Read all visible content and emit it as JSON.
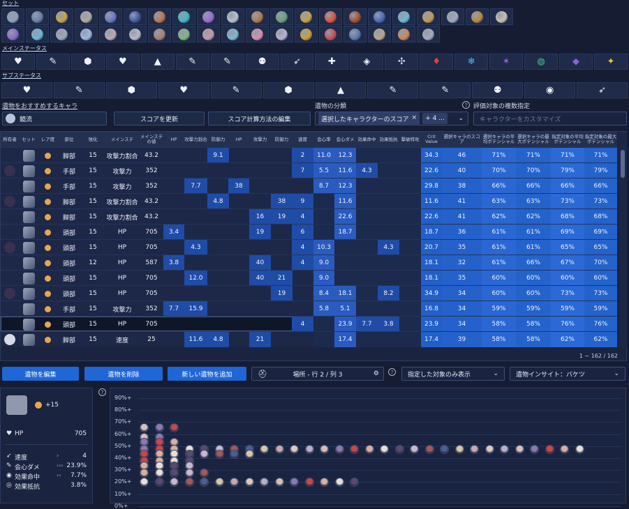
{
  "sections": {
    "set": "セット",
    "main_stat": "メインステータス",
    "sub_stat": "サブステータス"
  },
  "set_icons": {
    "row1": [
      "#8fa0b8",
      "#6a7fa8",
      "#c8a24a",
      "#b0a9a0",
      "#6b74c8",
      "#3c5aa8",
      "#b9764b",
      "#3bb8c8",
      "#9a6ad8",
      "#b8c0cc",
      "#b07a4a",
      "#6aa07a",
      "#c8a040",
      "#d8563a",
      "#a85030",
      "#4a6ab8",
      "#6ab8d0",
      "#c89850",
      "#a0a8c0",
      "#b88a3a",
      "#c8c0a8"
    ],
    "row2": [
      "#8a6ac8",
      "#6ab8d8",
      "#a0a8b8",
      "#9ab8e0",
      "#c0a8b0",
      "#b8b8c8",
      "#a88070",
      "#7ab880",
      "#c898a8",
      "#7ab8d0",
      "#d890a8",
      "#b8b0d0",
      "#c8a030",
      "#c85050",
      "#5a7ab0",
      "#b8a888",
      "#c88858",
      "#a8a8b8"
    ]
  },
  "main_stat_icons": [
    "hp-icon",
    "atk-percent-icon",
    "def-percent-icon",
    "heart-icon",
    "attack-icon",
    "crit-rate-icon",
    "crit-dmg-icon",
    "healing-icon",
    "energy-icon",
    "plus-icon",
    "effect-icon",
    "ice-grid-icon",
    "fire-icon",
    "ice-icon",
    "lightning-icon",
    "wind-icon",
    "quantum-icon",
    "imaginary-icon"
  ],
  "main_stat_glyphs": [
    "♥",
    "✎",
    "⬢",
    "♥",
    "▲",
    "✎",
    "✎",
    "⚉",
    "➶",
    "✚",
    "◈",
    "✣",
    "♦",
    "❄",
    "✶",
    "◍",
    "◆",
    "✦"
  ],
  "main_stat_colors": [
    "#eef2fa",
    "#eef2fa",
    "#eef2fa",
    "#eef2fa",
    "#eef2fa",
    "#eef2fa",
    "#eef2fa",
    "#eef2fa",
    "#eef2fa",
    "#eef2fa",
    "#eef2fa",
    "#c9d6f0",
    "#e0443a",
    "#5ab8e8",
    "#a060e0",
    "#40c890",
    "#8a60e0",
    "#e8c830"
  ],
  "sub_stat_glyphs": [
    "♥",
    "✎",
    "⬢",
    "♥",
    "✎",
    "⬢",
    "▲",
    "✎",
    "✎",
    "⚉",
    "◉",
    "➶"
  ],
  "labels": {
    "recommend_char": "遺物をおすすめするキャラ",
    "relic_class": "遺物の分類",
    "eval_target": "評価対象の複数指定",
    "char_name": "鏡流",
    "update_score": "スコアを更新",
    "edit_score": "スコア計算方法の編集",
    "chip": "選択したキャラクターのスコア",
    "chip_more": "+ 4 ...",
    "customize_placeholder": "キャラクターをカスタマイズ",
    "help": "?",
    "close": "×",
    "dropdown": "⌄"
  },
  "table": {
    "headers": [
      "所有者",
      "セット",
      "レア度",
      "部位",
      "強化",
      "メインステ",
      "メインステの値",
      "HP",
      "攻撃力割合",
      "防御力",
      "HP",
      "攻撃力",
      "防御力",
      "速度",
      "会心率",
      "会心ダメ",
      "効果命中",
      "効果抵抗",
      "撃破特攻",
      "Crit Value",
      "選択キャラのスコア",
      "選択キャラの平均ポテンシャル",
      "選択キャラの最大ポテンシャル",
      "指定対象の平均ポテンシャル",
      "指定対象の最大ポテンシャル"
    ],
    "rows": [
      {
        "owner": "",
        "slot": "脚部",
        "lvl": "15",
        "main": "攻撃力割合",
        "mv": "43.2",
        "hp": "",
        "atkp": "",
        "defp": "9.1",
        "hpf": "",
        "atk": "",
        "def": "",
        "spd": "2",
        "cr": "11.0",
        "cd": "12.3",
        "eh": "",
        "er": "",
        "be": "",
        "cv": "34.3",
        "score": "46",
        "p1": "71%",
        "p2": "71%",
        "p3": "71%",
        "p4": "71%"
      },
      {
        "owner": "y",
        "slot": "手部",
        "lvl": "15",
        "main": "攻撃力",
        "mv": "352",
        "hp": "",
        "atkp": "",
        "defp": "",
        "hpf": "",
        "atk": "",
        "def": "",
        "spd": "7",
        "cr": "5.5",
        "cd": "11.6",
        "eh": "4.3",
        "er": "",
        "be": "",
        "cv": "22.6",
        "score": "40",
        "p1": "70%",
        "p2": "70%",
        "p3": "79%",
        "p4": "79%"
      },
      {
        "owner": "",
        "slot": "手部",
        "lvl": "15",
        "main": "攻撃力",
        "mv": "352",
        "hp": "",
        "atkp": "7.7",
        "defp": "",
        "hpf": "38",
        "atk": "",
        "def": "",
        "spd": "",
        "cr": "8.7",
        "cd": "12.3",
        "eh": "",
        "er": "",
        "be": "",
        "cv": "29.8",
        "score": "38",
        "p1": "66%",
        "p2": "66%",
        "p3": "66%",
        "p4": "66%"
      },
      {
        "owner": "y",
        "slot": "脚部",
        "lvl": "15",
        "main": "攻撃力割合",
        "mv": "43.2",
        "hp": "",
        "atkp": "",
        "defp": "4.8",
        "hpf": "",
        "atk": "",
        "def": "38",
        "spd": "9",
        "cr": "",
        "cd": "11.6",
        "eh": "",
        "er": "",
        "be": "",
        "cv": "11.6",
        "score": "41",
        "p1": "63%",
        "p2": "63%",
        "p3": "73%",
        "p4": "73%"
      },
      {
        "owner": "",
        "slot": "脚部",
        "lvl": "15",
        "main": "攻撃力割合",
        "mv": "43.2",
        "hp": "",
        "atkp": "",
        "defp": "",
        "hpf": "",
        "atk": "16",
        "def": "19",
        "spd": "4",
        "cr": "",
        "cd": "22.6",
        "eh": "",
        "er": "",
        "be": "",
        "cv": "22.6",
        "score": "41",
        "p1": "62%",
        "p2": "62%",
        "p3": "68%",
        "p4": "68%"
      },
      {
        "owner": "",
        "slot": "頭部",
        "lvl": "15",
        "main": "HP",
        "mv": "705",
        "hp": "3.4",
        "atkp": "",
        "defp": "",
        "hpf": "",
        "atk": "19",
        "def": "",
        "spd": "6",
        "cr": "",
        "cd": "18.7",
        "eh": "",
        "er": "",
        "be": "",
        "cv": "18.7",
        "score": "36",
        "p1": "61%",
        "p2": "61%",
        "p3": "69%",
        "p4": "69%"
      },
      {
        "owner": "y",
        "slot": "頭部",
        "lvl": "15",
        "main": "HP",
        "mv": "705",
        "hp": "",
        "atkp": "4.3",
        "defp": "",
        "hpf": "",
        "atk": "",
        "def": "",
        "spd": "4",
        "cr": "10.3",
        "cd": "",
        "eh": "",
        "er": "4.3",
        "be": "",
        "cv": "20.7",
        "score": "35",
        "p1": "61%",
        "p2": "61%",
        "p3": "65%",
        "p4": "65%"
      },
      {
        "owner": "",
        "slot": "頭部",
        "lvl": "12",
        "main": "HP",
        "mv": "587",
        "hp": "3.8",
        "atkp": "",
        "defp": "",
        "hpf": "",
        "atk": "40",
        "def": "",
        "spd": "4",
        "cr": "9.0",
        "cd": "",
        "eh": "",
        "er": "",
        "be": "",
        "cv": "18.1",
        "score": "32",
        "p1": "61%",
        "p2": "66%",
        "p3": "67%",
        "p4": "70%"
      },
      {
        "owner": "",
        "slot": "頭部",
        "lvl": "15",
        "main": "HP",
        "mv": "705",
        "hp": "",
        "atkp": "12.0",
        "defp": "",
        "hpf": "",
        "atk": "40",
        "def": "21",
        "spd": "",
        "cr": "9.0",
        "cd": "",
        "eh": "",
        "er": "",
        "be": "",
        "cv": "18.1",
        "score": "35",
        "p1": "60%",
        "p2": "60%",
        "p3": "60%",
        "p4": "60%"
      },
      {
        "owner": "y",
        "slot": "頭部",
        "lvl": "15",
        "main": "HP",
        "mv": "705",
        "hp": "",
        "atkp": "",
        "defp": "",
        "hpf": "",
        "atk": "",
        "def": "19",
        "spd": "",
        "cr": "8.4",
        "cd": "18.1",
        "eh": "",
        "er": "8.2",
        "be": "",
        "cv": "34.9",
        "score": "34",
        "p1": "60%",
        "p2": "60%",
        "p3": "73%",
        "p4": "73%"
      },
      {
        "owner": "",
        "slot": "手部",
        "lvl": "15",
        "main": "攻撃力",
        "mv": "352",
        "hp": "7.7",
        "atkp": "15.9",
        "defp": "",
        "hpf": "",
        "atk": "",
        "def": "",
        "spd": "",
        "cr": "5.8",
        "cd": "5.1",
        "eh": "",
        "er": "",
        "be": "",
        "cv": "16.8",
        "score": "34",
        "p1": "59%",
        "p2": "59%",
        "p3": "59%",
        "p4": "59%"
      },
      {
        "owner": "",
        "slot": "頭部",
        "lvl": "15",
        "main": "HP",
        "mv": "705",
        "hp": "",
        "atkp": "",
        "defp": "",
        "hpf": "",
        "atk": "",
        "def": "",
        "spd": "4",
        "cr": "",
        "cd": "23.9",
        "eh": "7.7",
        "er": "3.8",
        "be": "",
        "cv": "23.9",
        "score": "34",
        "p1": "58%",
        "p2": "58%",
        "p3": "76%",
        "p4": "76%"
      },
      {
        "owner": "w",
        "slot": "脚部",
        "lvl": "15",
        "main": "速度",
        "mv": "25",
        "hp": "",
        "atkp": "11.6",
        "defp": "4.8",
        "hpf": "",
        "atk": "21",
        "def": "",
        "spd": "",
        "cr": "",
        "cd": "17.4",
        "eh": "",
        "er": "",
        "be": "",
        "cv": "17.4",
        "score": "39",
        "p1": "58%",
        "p2": "58%",
        "p3": "62%",
        "p4": "62%"
      }
    ],
    "count": "1 ~ 162 / 162"
  },
  "bottom": {
    "edit": "遺物を編集",
    "delete": "遺物を削除",
    "add": "新しい遺物を追加",
    "location": "場所 - 行 2 / 列 3",
    "filter": "指定した対象のみ表示",
    "insight": "遺物インサイト：バケツ"
  },
  "detail": {
    "level": "+15",
    "main_label": "HP",
    "main_value": "705",
    "subs": [
      {
        "icon": "speed-icon",
        "glyph": "➶",
        "name": "速度",
        "arrows": "›",
        "value": "4"
      },
      {
        "icon": "crit-dmg-icon",
        "glyph": "✎",
        "name": "会心ダメ",
        "arrows": "›››",
        "value": "23.9%"
      },
      {
        "icon": "effect-hit-icon",
        "glyph": "◉",
        "name": "効果命中",
        "arrows": "››",
        "value": "7.7%"
      },
      {
        "icon": "effect-res-icon",
        "glyph": "◎",
        "name": "効果抵抗",
        "arrows": "",
        "value": "3.8%"
      }
    ]
  },
  "chart_data": {
    "type": "scatter",
    "y_ticks": [
      "90%+",
      "80%+",
      "70%+",
      "60%+",
      "50%+",
      "40%+",
      "30%+",
      "20%+",
      "10%+",
      "0%+"
    ],
    "bucket_counts": {
      "60%+": 3,
      "50%+": 30,
      "40%+": 8,
      "20%+": 15
    }
  },
  "colors": {
    "accent": "#1f66d6",
    "rarity": "#e8a550"
  }
}
